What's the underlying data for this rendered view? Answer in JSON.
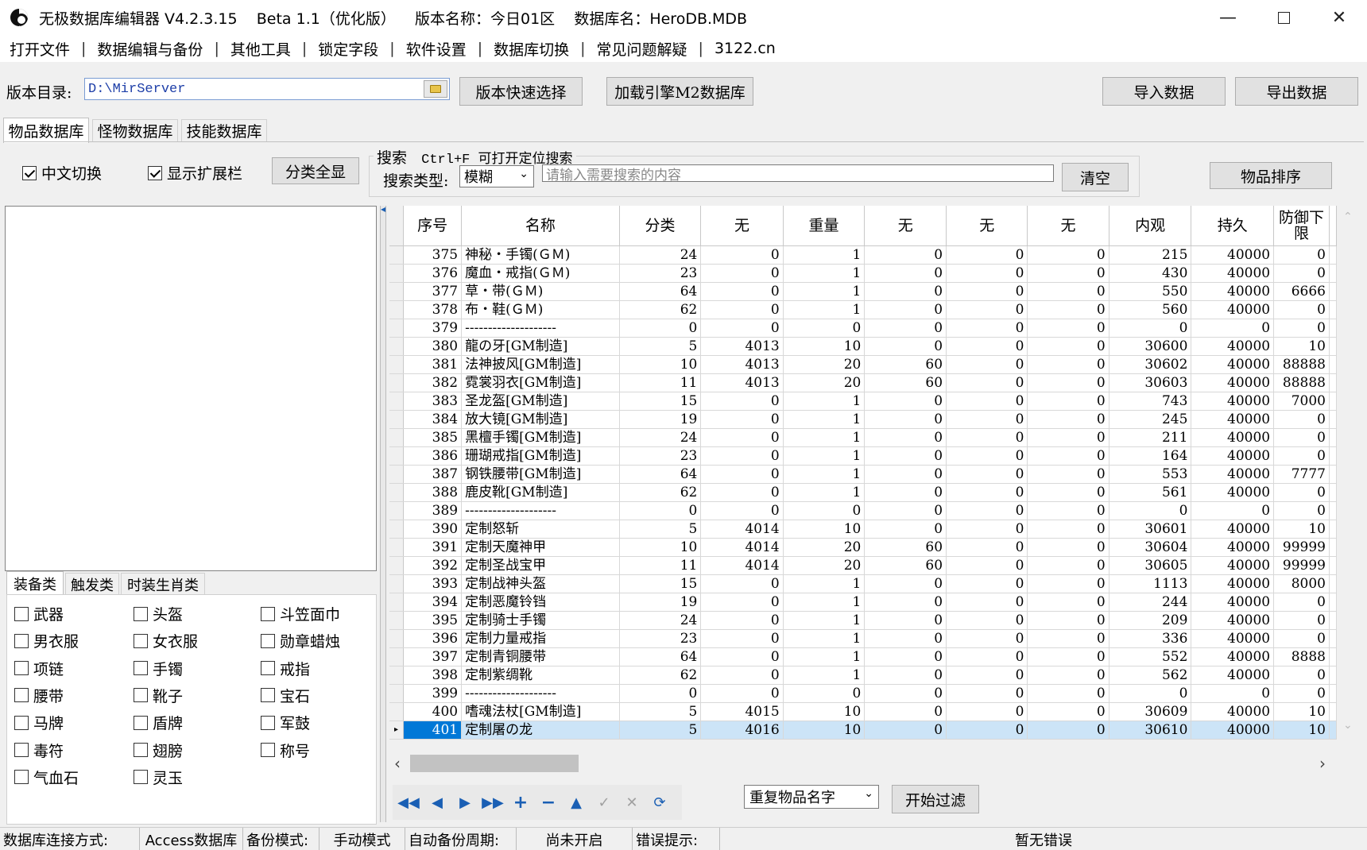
{
  "window": {
    "title": "无极数据库编辑器 V4.2.3.15    Beta 1.1（优化版）    版本名称：今日01区    数据库名：HeroDB.MDB",
    "minimize_icon": "minimize-icon",
    "maximize_icon": "maximize-icon",
    "close_icon": "close-icon"
  },
  "menu": [
    "打开文件",
    "数据编辑与备份",
    "其他工具",
    "锁定字段",
    "软件设置",
    "数据库切换",
    "常见问题解疑",
    "3122.cn"
  ],
  "toolbar": {
    "version_dir_label": "版本目录:",
    "version_dir_value": "D:\\MirServer",
    "quick_select_label": "版本快速选择",
    "load_m2_label": "加载引擎M2数据库",
    "import_label": "导入数据",
    "export_label": "导出数据"
  },
  "db_tabs": [
    "物品数据库",
    "怪物数据库",
    "技能数据库"
  ],
  "options": {
    "chinese_switch": {
      "label": "中文切换",
      "checked": true
    },
    "show_ext": {
      "label": "显示扩展栏",
      "checked": true
    },
    "show_all_label": "分类全显"
  },
  "search": {
    "group_title": "搜索",
    "hint": "Ctrl+F 可打开定位搜索",
    "type_label": "搜索类型:",
    "type_value": "模糊",
    "placeholder": "请输入需要搜索的内容",
    "clear_label": "清空",
    "sort_label": "物品排序"
  },
  "category_tabs": [
    "装备类",
    "触发类",
    "时装生肖类"
  ],
  "categories": [
    [
      "武器",
      "头盔",
      "斗笠面巾"
    ],
    [
      "男衣服",
      "女衣服",
      "勋章蜡烛"
    ],
    [
      "项链",
      "手镯",
      "戒指"
    ],
    [
      "腰带",
      "靴子",
      "宝石"
    ],
    [
      "马牌",
      "盾牌",
      "军鼓"
    ],
    [
      "毒符",
      "翅膀",
      "称号"
    ],
    [
      "气血石",
      "灵玉",
      ""
    ]
  ],
  "grid": {
    "columns": [
      "序号",
      "名称",
      "分类",
      "无",
      "重量",
      "无",
      "无",
      "无",
      "内观",
      "持久",
      "防御下限"
    ],
    "rows": [
      [
        "375",
        "神秘・手镯(ＧＭ)",
        "24",
        "0",
        "1",
        "0",
        "0",
        "0",
        "215",
        "40000",
        "0"
      ],
      [
        "376",
        "魔血・戒指(ＧＭ)",
        "23",
        "0",
        "1",
        "0",
        "0",
        "0",
        "430",
        "40000",
        "0"
      ],
      [
        "377",
        "草・带(ＧＭ)",
        "64",
        "0",
        "1",
        "0",
        "0",
        "0",
        "550",
        "40000",
        "6666"
      ],
      [
        "378",
        "布・鞋(ＧＭ)",
        "62",
        "0",
        "1",
        "0",
        "0",
        "0",
        "560",
        "40000",
        "0"
      ],
      [
        "379",
        "--------------------",
        "0",
        "0",
        "0",
        "0",
        "0",
        "0",
        "0",
        "0",
        "0"
      ],
      [
        "380",
        "龍の牙[GM制造]",
        "5",
        "4013",
        "10",
        "0",
        "0",
        "0",
        "30600",
        "40000",
        "10"
      ],
      [
        "381",
        "法神披风[GM制造]",
        "10",
        "4013",
        "20",
        "60",
        "0",
        "0",
        "30602",
        "40000",
        "88888"
      ],
      [
        "382",
        "霓裳羽衣[GM制造]",
        "11",
        "4013",
        "20",
        "60",
        "0",
        "0",
        "30603",
        "40000",
        "88888"
      ],
      [
        "383",
        "圣龙盔[GM制造]",
        "15",
        "0",
        "1",
        "0",
        "0",
        "0",
        "743",
        "40000",
        "7000"
      ],
      [
        "384",
        "放大镜[GM制造]",
        "19",
        "0",
        "1",
        "0",
        "0",
        "0",
        "245",
        "40000",
        "0"
      ],
      [
        "385",
        "黑檀手镯[GM制造]",
        "24",
        "0",
        "1",
        "0",
        "0",
        "0",
        "211",
        "40000",
        "0"
      ],
      [
        "386",
        "珊瑚戒指[GM制造]",
        "23",
        "0",
        "1",
        "0",
        "0",
        "0",
        "164",
        "40000",
        "0"
      ],
      [
        "387",
        "钢铁腰带[GM制造]",
        "64",
        "0",
        "1",
        "0",
        "0",
        "0",
        "553",
        "40000",
        "7777"
      ],
      [
        "388",
        "鹿皮靴[GM制造]",
        "62",
        "0",
        "1",
        "0",
        "0",
        "0",
        "561",
        "40000",
        "0"
      ],
      [
        "389",
        "--------------------",
        "0",
        "0",
        "0",
        "0",
        "0",
        "0",
        "0",
        "0",
        "0"
      ],
      [
        "390",
        "定制怒斩",
        "5",
        "4014",
        "10",
        "0",
        "0",
        "0",
        "30601",
        "40000",
        "10"
      ],
      [
        "391",
        "定制天魔神甲",
        "10",
        "4014",
        "20",
        "60",
        "0",
        "0",
        "30604",
        "40000",
        "99999"
      ],
      [
        "392",
        "定制圣战宝甲",
        "11",
        "4014",
        "20",
        "60",
        "0",
        "0",
        "30605",
        "40000",
        "99999"
      ],
      [
        "393",
        "定制战神头盔",
        "15",
        "0",
        "1",
        "0",
        "0",
        "0",
        "1113",
        "40000",
        "8000"
      ],
      [
        "394",
        "定制恶魔铃铛",
        "19",
        "0",
        "1",
        "0",
        "0",
        "0",
        "244",
        "40000",
        "0"
      ],
      [
        "395",
        "定制骑士手镯",
        "24",
        "0",
        "1",
        "0",
        "0",
        "0",
        "209",
        "40000",
        "0"
      ],
      [
        "396",
        "定制力量戒指",
        "23",
        "0",
        "1",
        "0",
        "0",
        "0",
        "336",
        "40000",
        "0"
      ],
      [
        "397",
        "定制青铜腰带",
        "64",
        "0",
        "1",
        "0",
        "0",
        "0",
        "552",
        "40000",
        "8888"
      ],
      [
        "398",
        "定制紫绸靴",
        "62",
        "0",
        "1",
        "0",
        "0",
        "0",
        "562",
        "40000",
        "0"
      ],
      [
        "399",
        "--------------------",
        "0",
        "0",
        "0",
        "0",
        "0",
        "0",
        "0",
        "0",
        "0"
      ],
      [
        "400",
        "嗜魂法杖[GM制造]",
        "5",
        "4015",
        "10",
        "0",
        "0",
        "0",
        "30609",
        "40000",
        "10"
      ],
      [
        "401",
        "定制屠の龙",
        "5",
        "4016",
        "10",
        "0",
        "0",
        "0",
        "30610",
        "40000",
        "10"
      ]
    ],
    "selected_row": 26
  },
  "navigator": {
    "icons": [
      "first-icon",
      "prior-icon",
      "next-icon",
      "last-icon",
      "insert-icon",
      "delete-icon",
      "edit-icon",
      "post-icon",
      "cancel-icon",
      "refresh-icon"
    ]
  },
  "filter": {
    "dropdown_value": "重复物品名字",
    "start_label": "开始过滤"
  },
  "status": {
    "conn_label": "数据库连接方式:",
    "conn_value": "Access数据库",
    "backup_label": "备份模式:",
    "backup_value": "手动模式",
    "auto_label": "自动备份周期:",
    "auto_value": "尚未开启",
    "error_label": "错误提示:",
    "error_value": "暂无错误"
  }
}
